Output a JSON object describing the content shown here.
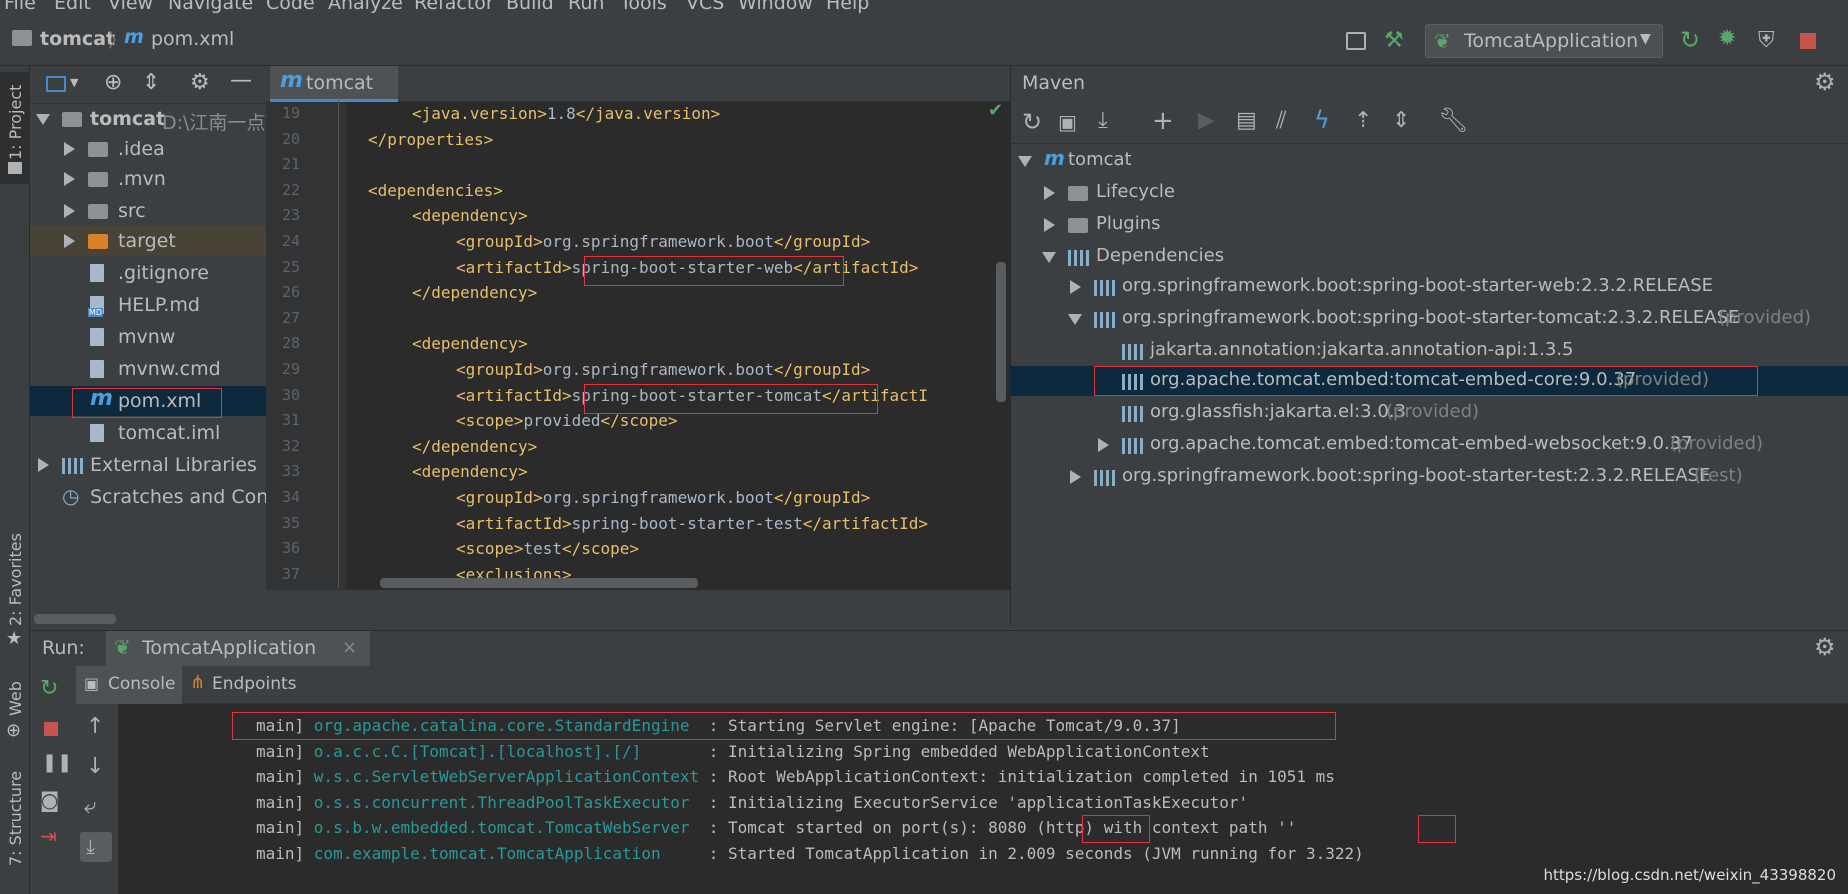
{
  "menu": [
    "File",
    "Edit",
    "View",
    "Navigate",
    "Code",
    "Analyze",
    "Refactor",
    "Build",
    "Run",
    "Tools",
    "VCS",
    "Window",
    "Help"
  ],
  "breadcrumb": {
    "project": "tomcat",
    "file": "pom.xml"
  },
  "run_config": {
    "label": "TomcatApplication"
  },
  "side_tabs": {
    "project": "1: Project",
    "favorites": "2: Favorites",
    "web": "Web",
    "structure": "7: Structure"
  },
  "project_tree": {
    "root_name": "tomcat",
    "root_path": "D:\\江南一点\\",
    "items": [
      ".idea",
      ".mvn",
      "src",
      "target",
      ".gitignore",
      "HELP.md",
      "mvnw",
      "mvnw.cmd",
      "pom.xml",
      "tomcat.iml"
    ],
    "external": "External Libraries",
    "scratches": "Scratches and Consoles",
    "md_badge": "MD"
  },
  "editor": {
    "tab_label": "tomcat",
    "lines": [
      {
        "n": "19",
        "indent": 1,
        "pre": "<java.version>",
        "txt": "1.8",
        "post": "</java.version>"
      },
      {
        "n": "20",
        "indent": 0,
        "pre": "</properties>",
        "txt": "",
        "post": ""
      },
      {
        "n": "21",
        "indent": 0,
        "pre": "",
        "txt": "",
        "post": ""
      },
      {
        "n": "22",
        "indent": 0,
        "pre": "<dependencies>",
        "txt": "",
        "post": ""
      },
      {
        "n": "23",
        "indent": 1,
        "pre": "<dependency>",
        "txt": "",
        "post": ""
      },
      {
        "n": "24",
        "indent": 2,
        "pre": "<groupId>",
        "txt": "org.springframework.boot",
        "post": "</groupId>"
      },
      {
        "n": "25",
        "indent": 2,
        "pre": "<artifactId>",
        "txt": "spring-boot-starter-web",
        "post": "</artifactId>"
      },
      {
        "n": "26",
        "indent": 1,
        "pre": "</dependency>",
        "txt": "",
        "post": ""
      },
      {
        "n": "27",
        "indent": 0,
        "pre": "",
        "txt": "",
        "post": ""
      },
      {
        "n": "28",
        "indent": 1,
        "pre": "<dependency>",
        "txt": "",
        "post": ""
      },
      {
        "n": "29",
        "indent": 2,
        "pre": "<groupId>",
        "txt": "org.springframework.boot",
        "post": "</groupId>"
      },
      {
        "n": "30",
        "indent": 2,
        "pre": "<artifactId>",
        "txt": "spring-boot-starter-tomcat",
        "post": "</artifactI"
      },
      {
        "n": "31",
        "indent": 2,
        "pre": "<scope>",
        "txt": "provided",
        "post": "</scope>"
      },
      {
        "n": "32",
        "indent": 1,
        "pre": "</dependency>",
        "txt": "",
        "post": ""
      },
      {
        "n": "33",
        "indent": 1,
        "pre": "<dependency>",
        "txt": "",
        "post": ""
      },
      {
        "n": "34",
        "indent": 2,
        "pre": "<groupId>",
        "txt": "org.springframework.boot",
        "post": "</groupId>"
      },
      {
        "n": "35",
        "indent": 2,
        "pre": "<artifactId>",
        "txt": "spring-boot-starter-test",
        "post": "</artifactId>"
      },
      {
        "n": "36",
        "indent": 2,
        "pre": "<scope>",
        "txt": "test",
        "post": "</scope>"
      },
      {
        "n": "37",
        "indent": 2,
        "pre": "<exclusions>",
        "txt": "",
        "post": ""
      }
    ]
  },
  "maven": {
    "title": "Maven",
    "root": "tomcat",
    "lifecycle": "Lifecycle",
    "plugins": "Plugins",
    "dependencies": "Dependencies",
    "deps": [
      {
        "name": "org.springframework.boot:spring-boot-starter-web:2.3.2.RELEASE",
        "scope": ""
      },
      {
        "name": "org.springframework.boot:spring-boot-starter-tomcat:2.3.2.RELEASE",
        "scope": "(provided)"
      },
      {
        "name": "jakarta.annotation:jakarta.annotation-api:1.3.5",
        "scope": ""
      },
      {
        "name": "org.apache.tomcat.embed:tomcat-embed-core:9.0.37",
        "scope": "(provided)"
      },
      {
        "name": "org.glassfish:jakarta.el:3.0.3",
        "scope": "(provided)"
      },
      {
        "name": "org.apache.tomcat.embed:tomcat-embed-websocket:9.0.37",
        "scope": "(provided)"
      },
      {
        "name": "org.springframework.boot:spring-boot-starter-test:2.3.2.RELEASE",
        "scope": "(test)"
      }
    ]
  },
  "run": {
    "label": "Run:",
    "tab": "TomcatApplication",
    "console_tab": "Console",
    "endpoints_tab": "Endpoints",
    "log": [
      {
        "thread": "main]",
        "cls": "org.apache.catalina.core.StandardEngine",
        "msg": ": Starting Servlet engine: [Apache Tomcat/9.0.37]"
      },
      {
        "thread": "main]",
        "cls": "o.a.c.c.C.[Tomcat].[localhost].[/]",
        "msg": ": Initializing Spring embedded WebApplicationContext"
      },
      {
        "thread": "main]",
        "cls": "w.s.c.ServletWebServerApplicationContext",
        "msg": ": Root WebApplicationContext: initialization completed in 1051 ms"
      },
      {
        "thread": "main]",
        "cls": "o.s.s.concurrent.ThreadPoolTaskExecutor",
        "msg": ": Initializing ExecutorService 'applicationTaskExecutor'"
      },
      {
        "thread": "main]",
        "cls": "o.s.b.w.embedded.tomcat.TomcatWebServer",
        "msg": ": Tomcat started on port(s): 8080 (http) with context path ''"
      },
      {
        "thread": "main]",
        "cls": "com.example.tomcat.TomcatApplication",
        "msg": ": Started TomcatApplication in 2.009 seconds (JVM running for 3.322)"
      }
    ]
  },
  "watermark": "https://blog.csdn.net/weixin_43398820",
  "colors": {
    "tag": "#e8bf6a",
    "text": "#a9b7c6",
    "class": "#299999",
    "highlight": "#e0353b",
    "selected": "#0d293e"
  }
}
